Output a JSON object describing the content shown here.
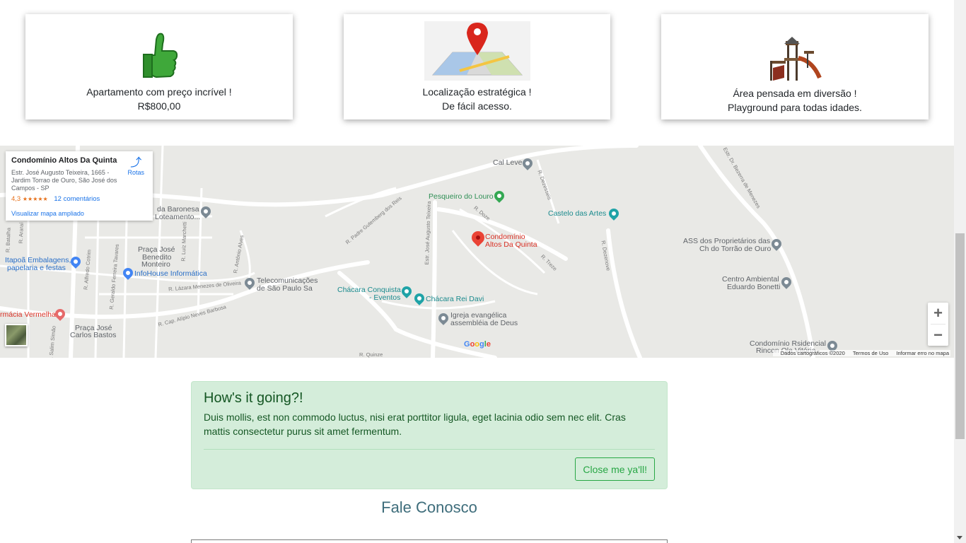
{
  "cards": [
    {
      "line1": "Apartamento com preço incrível !",
      "line2": "R$800,00",
      "icon": "thumbs-up-icon"
    },
    {
      "line1": "Localização estratégica !",
      "line2": "De fácil acesso.",
      "icon": "map-location-icon"
    },
    {
      "line1": "Área pensada em diversão !",
      "line2": "Playground para todas idades.",
      "icon": "playground-icon"
    }
  ],
  "map": {
    "info": {
      "title": "Condomínio Altos Da Quinta",
      "address": "Estr. José Augusto Teixeira, 1665 - Jardim Torrao de Ouro, São José dos Campos - SP",
      "rating": "4,3",
      "stars": "★★★★★",
      "reviews": "12 comentários",
      "view_larger": "Visualizar mapa ampliado",
      "directions": "Rotas"
    },
    "labels": {
      "cal_leve": "Cal Leve",
      "pesqueiro": "Pesqueiro do Louro",
      "castelo": "Castelo das Artes",
      "condominio_1": "Condomínio",
      "condominio_2": "Altos Da Quinta",
      "ass_1": "ASS dos Proprietários das",
      "ass_2": "Ch do Torrão de Ouro",
      "centro_1": "Centro Ambiental",
      "centro_2": "Eduardo Bonetti",
      "baronesa_1": "da Baronesa",
      "baronesa_2": "Loteamento...",
      "praca_jose_1": "Praça José",
      "praca_jose_2": "Benedito",
      "praca_jose_3": "Monteiro",
      "itapoa_1": "Itapoã Embalagens,",
      "itapoa_2": "papelaria e festas",
      "infohouse": "InfoHouse Informática",
      "telecom_1": "Telecomunicações",
      "telecom_2": "de São Paulo Sa",
      "chacara_conquista_1": "Chácara Conquista",
      "chacara_conquista_2": "- Eventos",
      "chacara_rei": "Chácara Rei Davi",
      "igreja_1": "Igreja evangélica",
      "igreja_2": "assembléia de Deus",
      "farmacia": "rmácia Vermelha",
      "praca_carlos_1": "Praça José",
      "praca_carlos_2": "Carlos Bastos",
      "condominio_res_1": "Condomínio Rsidencial",
      "condominio_res_2": "Rincon Ola Vitória",
      "estr_bezerra": "Estr. Dr. Bezerra de Menezes",
      "r_padre": "R. Padre Gutemberg dos Reis",
      "estr_jose": "Estr. José Augusto Teixeira",
      "r_lazara": "R. Lázara Menezes de Oliveira",
      "r_cap": "R. Cap. Alípio Neves Barbosa",
      "r_quinze": "R. Quinze",
      "r_doze": "R. Doze",
      "r_treze": "R. Treze",
      "r_dezesseis": "R. Dezesseis",
      "r_dezenove": "R. Dezenove",
      "r_alfredo": "R. Alfredo Cotrim",
      "r_geraldo": "R. Geraldo Ferreira Tavares",
      "r_luiz": "R. Luiz Marchetti",
      "r_antonio": "R. Antônio Alves",
      "r_salim": "R. Salim Simão",
      "r_batalha": "R. Batalha",
      "r_ararai": "R. Araraí"
    },
    "google": "Google",
    "footer": {
      "data": "Dados cartográficos ©2020",
      "terms": "Termos de Uso",
      "report": "Informar erro no mapa"
    },
    "zoom_in": "+",
    "zoom_out": "−"
  },
  "alert": {
    "heading": "How's it going?!",
    "body": "Duis mollis, est non commodo luctus, nisi erat porttitor ligula, eget lacinia odio sem nec elit. Cras mattis consectetur purus sit amet fermentum.",
    "button": "Close me ya'll!"
  },
  "contact": {
    "title": "Fale Conosco"
  },
  "colors": {
    "alert_bg": "#d4edda",
    "alert_text": "#155724",
    "button": "#28a745",
    "title": "#3e6d7b",
    "main_pin": "#ea4335"
  }
}
